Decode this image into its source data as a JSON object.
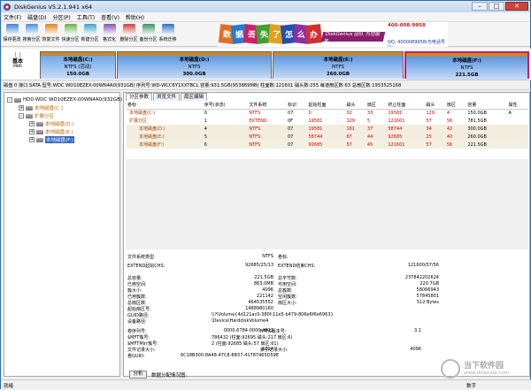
{
  "window": {
    "title": "DiskGenius V5.2.1.941 x64"
  },
  "menu": [
    "文件(F)",
    "磁盘(D)",
    "分区(P)",
    "工具(T)",
    "查看(V)",
    "帮助(H)"
  ],
  "toolbar": [
    {
      "label": "保存更改",
      "icon": "save-icon",
      "color": "#3a7fd0"
    },
    {
      "label": "搜索分区",
      "icon": "search-icon",
      "color": "#4a90d8"
    },
    {
      "label": "恢复文件",
      "icon": "recover-icon",
      "color": "#e08020"
    },
    {
      "label": "快速分区",
      "icon": "quick-partition-icon",
      "color": "#6ab04a"
    },
    {
      "label": "新建分区",
      "icon": "new-partition-icon",
      "color": "#3aa0d0"
    },
    {
      "label": "格式化",
      "icon": "format-icon",
      "color": "#8050c0"
    },
    {
      "label": "删除分区",
      "icon": "delete-icon",
      "color": "#d04040"
    },
    {
      "label": "备份分区",
      "icon": "backup-icon",
      "color": "#3a9060"
    },
    {
      "label": "系统迁移",
      "icon": "migrate-icon",
      "color": "#2a70c0"
    }
  ],
  "banner": {
    "chars": [
      {
        "t": "数",
        "c": "#e07020"
      },
      {
        "t": "据",
        "c": "#2a7ad0"
      },
      {
        "t": "丢",
        "c": "#d02060"
      },
      {
        "t": "失",
        "c": "#40a030"
      },
      {
        "t": "了",
        "c": "#e0a020"
      },
      {
        "t": "怎",
        "c": "#2050b0"
      },
      {
        "t": "么",
        "c": "#8a30a0"
      },
      {
        "t": "办",
        "c": "#d03030"
      }
    ],
    "brand": "DiskGenius 团队 为您服务",
    "phone1": "400-008-9958",
    "phone2": "QQ: 4000089958(与电话号码)"
  },
  "diskmap": {
    "basic": "基本",
    "mbr": "MBR",
    "partitions": [
      {
        "name": "本地磁盘(C:)",
        "line2": "NTFS (活动)",
        "size": "150.0GB",
        "color": "#6fa8e8"
      },
      {
        "name": "本地磁盘(D:)",
        "line2": "NTFS",
        "size": "300.0GB",
        "color": "#5a96e0"
      },
      {
        "name": "本地磁盘(E:)",
        "line2": "NTFS",
        "size": "260.0GB",
        "color": "#5a96e0"
      },
      {
        "name": "本地磁盘(F:)",
        "line2": "NTFS",
        "size": "221.5GB",
        "color": "#5a96e0"
      }
    ],
    "strip_color": "#c58a2a"
  },
  "infoline": "磁盘 0 接口:SATA  型号:WDC WD10EZEX-00WN4A0(931GB)  序列号:WD-WCC6Y1XXTBCL  容量:931.5GB(953869MB)  柱面数:121601  磁头数:255  每道扇区数:63  总扇区数:1953525168",
  "tree": [
    {
      "text": "HD0:WDC WD10EZEX-00WN4A0(932GB)",
      "kind": "disk",
      "exp": "-"
    },
    {
      "text": "本地磁盘(C:)",
      "kind": "part",
      "exp": "+"
    },
    {
      "text": "扩展分区",
      "kind": "ext",
      "exp": "-"
    },
    {
      "text": "本地磁盘(D:)",
      "kind": "part",
      "exp": "+"
    },
    {
      "text": "本地磁盘(E:)",
      "kind": "part",
      "exp": "+"
    },
    {
      "text": "本地磁盘(F:)",
      "kind": "sel",
      "exp": "+"
    }
  ],
  "tabs": [
    "分区参数",
    "浏览文件",
    "扇区编辑"
  ],
  "table": {
    "headers": [
      "卷标",
      "序号(状态)",
      "文件系统",
      "标识",
      "起始柱面",
      "磁头",
      "扇区",
      "终止柱面",
      "磁头",
      "扇区",
      "容量",
      "属性"
    ],
    "rows": [
      [
        "本地磁盘(C:)",
        "0",
        "NTFS",
        "07",
        "0",
        "32",
        "33",
        "19581",
        "129",
        "4",
        "150.0GB",
        "A"
      ],
      [
        "扩展分区",
        "1",
        "EXTEND",
        "0F",
        "19581",
        "129",
        "5",
        "121601",
        "57",
        "56",
        "781.5GB",
        ""
      ],
      [
        "本地磁盘(D:)",
        "4",
        "NTFS",
        "07",
        "19581",
        "161",
        "37",
        "58744",
        "34",
        "42",
        "300.0GB",
        ""
      ],
      [
        "本地磁盘(E:)",
        "5",
        "NTFS",
        "07",
        "58744",
        "67",
        "44",
        "92685",
        "25",
        "40",
        "260.0GB",
        ""
      ],
      [
        "本地磁盘(F:)",
        "6",
        "NTFS",
        "07",
        "92685",
        "57",
        "45",
        "121601",
        "57",
        "56",
        "221.5GB",
        ""
      ]
    ]
  },
  "details": {
    "fs_type_label": "文件系统类型:",
    "fs_type": "NTFS",
    "vol_label": "卷标:",
    "vol_value": "",
    "ext_start_label": "EXTEND起始CHS:",
    "ext_start": "92685/25/13",
    "ext_end_label": "EXTEND结束CHS:",
    "ext_end": "121600/57/56",
    "cap_label": "总容量:",
    "cap": "221.5GB",
    "bytes_label": "总字节数:",
    "bytes": "237842202624",
    "used_label": "已用空间:",
    "used": "863.0MB",
    "free_label": "可用空间:",
    "free": "220.7GB",
    "cluster_label": "簇大小:",
    "cluster": "4096",
    "clusters_label": "总簇数:",
    "clusters": "58066943",
    "usedc_label": "已用簇数:",
    "usedc": "221142",
    "freec_label": "空闲簇数:",
    "freec": "57845801",
    "sectors_label": "总扇区数:",
    "sectors": "464535552",
    "secsize_label": "扇区大小:",
    "secsize": "512 Bytes",
    "startsec_label": "起始扇区号:",
    "startsec": "1488980160",
    "guid_label": "GUID路径:",
    "guid": "\\\\?\\Volume{4d121ac0-380f-11e5-b479-806e6f6e6963}",
    "dev_label": "设备路径:",
    "dev": "\\Device\\HarddiskVolume4",
    "serial_label": "卷序列号:",
    "serial": "0000-6784-0000-4823",
    "ver_label": "NTFS版本号:",
    "ver": "3.1",
    "mft_label": "$MFT簇号:",
    "mft": "786432 (柱面:92695 磁头:217 扇区:6)",
    "mftmirr_label": "$MFTMirr簇号:",
    "mftmirr": "2 (柱面:92685 磁头:57 扇区:61)",
    "frs_label": "文件记录大小:",
    "frs": "1024",
    "idx_label": "索引记录大小:",
    "idx": "4096",
    "volguid_label": "卷GUID:",
    "volguid": "6C18B300-8A48-47C8-8B37-41787465D59E"
  },
  "analyze_button": "分析",
  "analyze_label": "数据分配情况图:",
  "status": {
    "left": "就绪",
    "right": "数字"
  },
  "watermark": {
    "t1": "当下软件园",
    "t2": "www.downxia.com"
  }
}
